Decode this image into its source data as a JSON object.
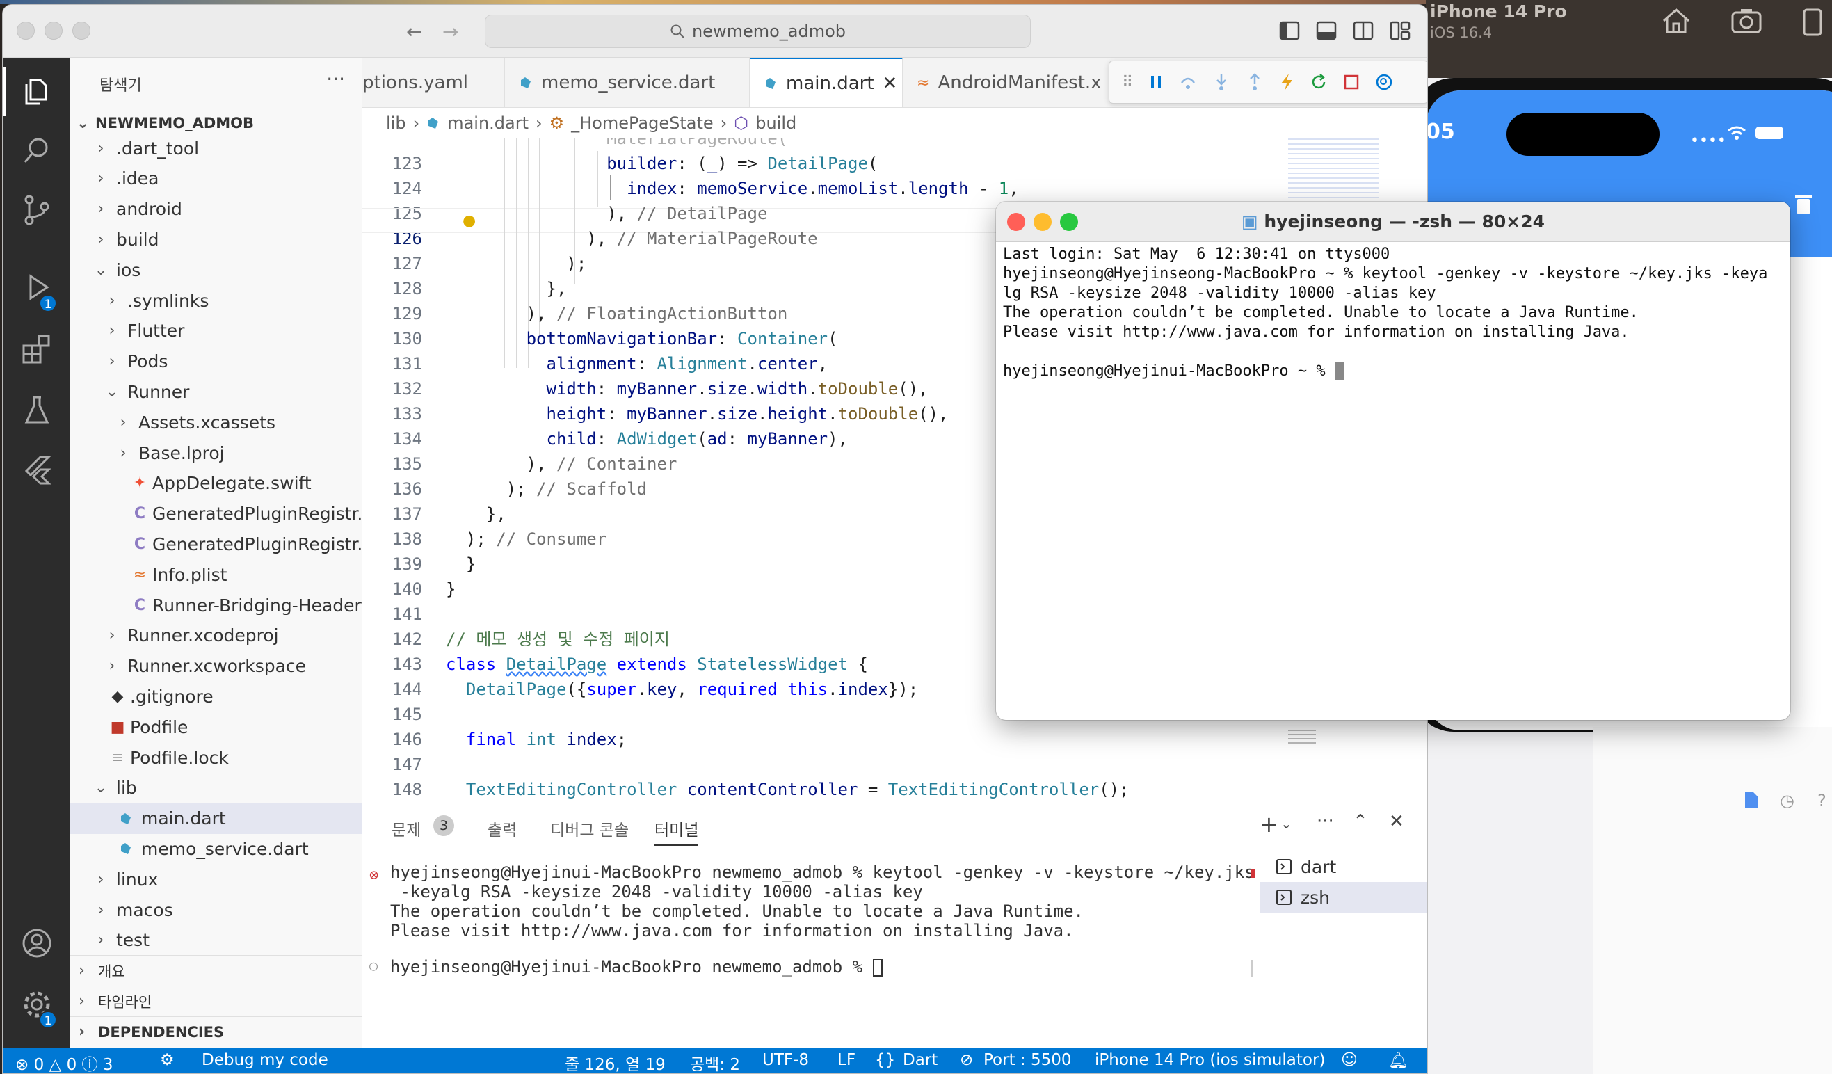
{
  "desktop": {
    "simulator": {
      "title": "iPhone 14 Pro",
      "subtitle": "iOS 16.4",
      "clock": "05"
    }
  },
  "vscode": {
    "search_text": "newmemo_admob",
    "explorer": {
      "header": "탐색기",
      "root": "NEWMEMO_ADMOB",
      "items": [
        {
          "label": ".dart_tool",
          "type": "folder"
        },
        {
          "label": ".idea",
          "type": "folder"
        },
        {
          "label": "android",
          "type": "folder"
        },
        {
          "label": "build",
          "type": "folder"
        },
        {
          "label": "ios",
          "type": "folder-open"
        },
        {
          "label": ".symlinks",
          "type": "folder"
        },
        {
          "label": "Flutter",
          "type": "folder"
        },
        {
          "label": "Pods",
          "type": "folder"
        },
        {
          "label": "Runner",
          "type": "folder-open"
        },
        {
          "label": "Assets.xcassets",
          "type": "folder"
        },
        {
          "label": "Base.lproj",
          "type": "folder"
        },
        {
          "label": "AppDelegate.swift",
          "type": "swift"
        },
        {
          "label": "GeneratedPluginRegistr...",
          "type": "c"
        },
        {
          "label": "GeneratedPluginRegistr...",
          "type": "c"
        },
        {
          "label": "Info.plist",
          "type": "rss"
        },
        {
          "label": "Runner-Bridging-Header...",
          "type": "c"
        },
        {
          "label": "Runner.xcodeproj",
          "type": "folder"
        },
        {
          "label": "Runner.xcworkspace",
          "type": "folder"
        },
        {
          "label": ".gitignore",
          "type": "git"
        },
        {
          "label": "Podfile",
          "type": "ruby"
        },
        {
          "label": "Podfile.lock",
          "type": "lines"
        },
        {
          "label": "lib",
          "type": "folder-open"
        },
        {
          "label": "main.dart",
          "type": "dart"
        },
        {
          "label": "memo_service.dart",
          "type": "dart"
        },
        {
          "label": "linux",
          "type": "folder"
        },
        {
          "label": "macos",
          "type": "folder"
        },
        {
          "label": "test",
          "type": "folder"
        }
      ],
      "sections": [
        "개요",
        "타임라인",
        "DEPENDENCIES"
      ]
    },
    "tabs": [
      {
        "label": "ptions.yaml",
        "icon": "none"
      },
      {
        "label": "memo_service.dart",
        "icon": "dart"
      },
      {
        "label": "main.dart",
        "icon": "dart"
      },
      {
        "label": "AndroidManifest.x",
        "icon": "rss"
      }
    ],
    "breadcrumb": [
      "lib",
      "main.dart",
      "_HomePageState",
      "build"
    ],
    "line_numbers": [
      "123",
      "124",
      "125",
      "126",
      "127",
      "128",
      "129",
      "130",
      "131",
      "132",
      "133",
      "134",
      "135",
      "136",
      "137",
      "138",
      "139",
      "140",
      "141",
      "142",
      "143",
      "144",
      "145",
      "146",
      "147",
      "148"
    ],
    "panel": {
      "tabs": [
        "문제",
        "출력",
        "디버그 콘솔",
        "터미널"
      ],
      "problems_count": "3",
      "terminal_lines": [
        "hyejinseong@Hyejinui-MacBookPro newmemo_admob % keytool -genkey -v -keystore ~/key.jks",
        " -keyalg RSA -keysize 2048 -validity 10000 -alias key",
        "The operation couldn’t be completed. Unable to locate a Java Runtime.",
        "Please visit http://www.java.com for information on installing Java.",
        "hyejinseong@Hyejinui-MacBookPro newmemo_admob % "
      ],
      "terminals": [
        "dart",
        "zsh"
      ]
    },
    "status": {
      "problems": "0",
      "warnings": "0",
      "info": "3",
      "debug": "Debug my code",
      "position": "줄 126, 열 19",
      "spaces": "공백: 2",
      "encoding": "UTF-8",
      "eol": "LF",
      "language": "Dart",
      "port": "Port : 5500",
      "device": "iPhone 14 Pro (ios simulator)",
      "debug_badge": "1",
      "settings_badge": "1"
    }
  },
  "terminal_window": {
    "title": "hyejinseong — -zsh — 80×24",
    "lines": [
      "Last login: Sat May  6 12:30:41 on ttys000",
      "hyejinseong@Hyejinseong-MacBookPro ~ % keytool -genkey -v -keystore ~/key.jks -keya",
      "lg RSA -keysize 2048 -validity 10000 -alias key",
      "The operation couldn’t be completed. Unable to locate a Java Runtime.",
      "Please visit http://www.java.com for information on installing Java.",
      "",
      "hyejinseong@Hyejinui-MacBookPro ~ % "
    ]
  },
  "colors": {
    "accent": "#0078d4",
    "status_bar": "#0078d4",
    "phone_appbar": "#3d8ff6"
  }
}
